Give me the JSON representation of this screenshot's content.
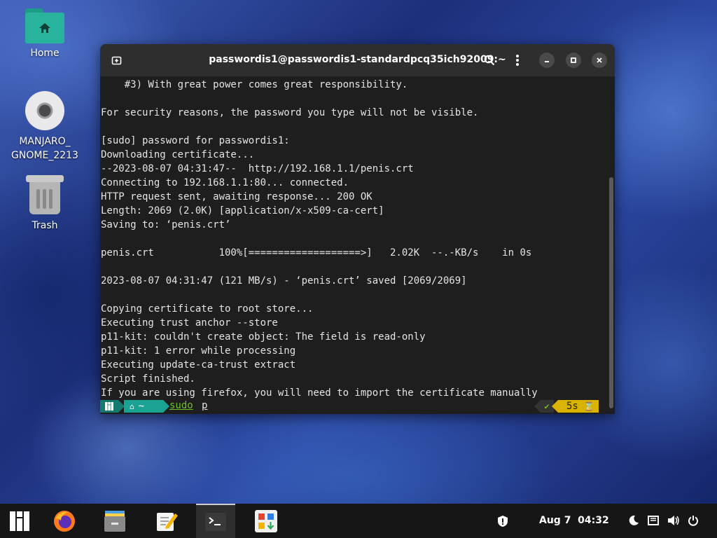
{
  "desktop": {
    "icons": [
      {
        "label": "Home",
        "icon": "home-folder-icon"
      },
      {
        "label": "MANJARO_\nGNOME_2213",
        "icon": "optical-disc-icon"
      },
      {
        "label": "Trash",
        "icon": "trash-icon"
      }
    ]
  },
  "terminal": {
    "title": "passwordis1@passwordis1-standardpcq35ich92009:~",
    "lines": [
      "    #3) With great power comes great responsibility.",
      "",
      "For security reasons, the password you type will not be visible.",
      "",
      "[sudo] password for passwordis1:",
      "Downloading certificate...",
      "--2023-08-07 04:31:47--  http://192.168.1.1/penis.crt",
      "Connecting to 192.168.1.1:80... connected.",
      "HTTP request sent, awaiting response... 200 OK",
      "Length: 2069 (2.0K) [application/x-x509-ca-cert]",
      "Saving to: ‘penis.crt’",
      "",
      "penis.crt           100%[===================>]   2.02K  --.-KB/s    in 0s",
      "",
      "2023-08-07 04:31:47 (121 MB/s) - ‘penis.crt’ saved [2069/2069]",
      "",
      "Copying certificate to root store...",
      "Executing trust anchor --store",
      "p11-kit: couldn't create object: The field is read-only",
      "p11-kit: 1 error while processing",
      "Executing update-ca-trust extract",
      "Script finished.",
      "If you are using firefox, you will need to import the certificate manually"
    ],
    "prompt": {
      "dir": "~",
      "command": "sudo",
      "typed": "p",
      "status_check": "✔",
      "duration": "5s"
    },
    "colors": {
      "segment_teal": "#1aa392",
      "segment_yellow": "#d9b300",
      "command_green": "#6fbf2a"
    }
  },
  "taskbar": {
    "apps": [
      {
        "name": "manjaro-menu-icon"
      },
      {
        "name": "firefox-icon"
      },
      {
        "name": "file-manager-icon"
      },
      {
        "name": "text-editor-icon"
      },
      {
        "name": "terminal-icon",
        "active": true
      },
      {
        "name": "software-center-icon"
      }
    ],
    "clock": "Aug 7  04:32"
  }
}
